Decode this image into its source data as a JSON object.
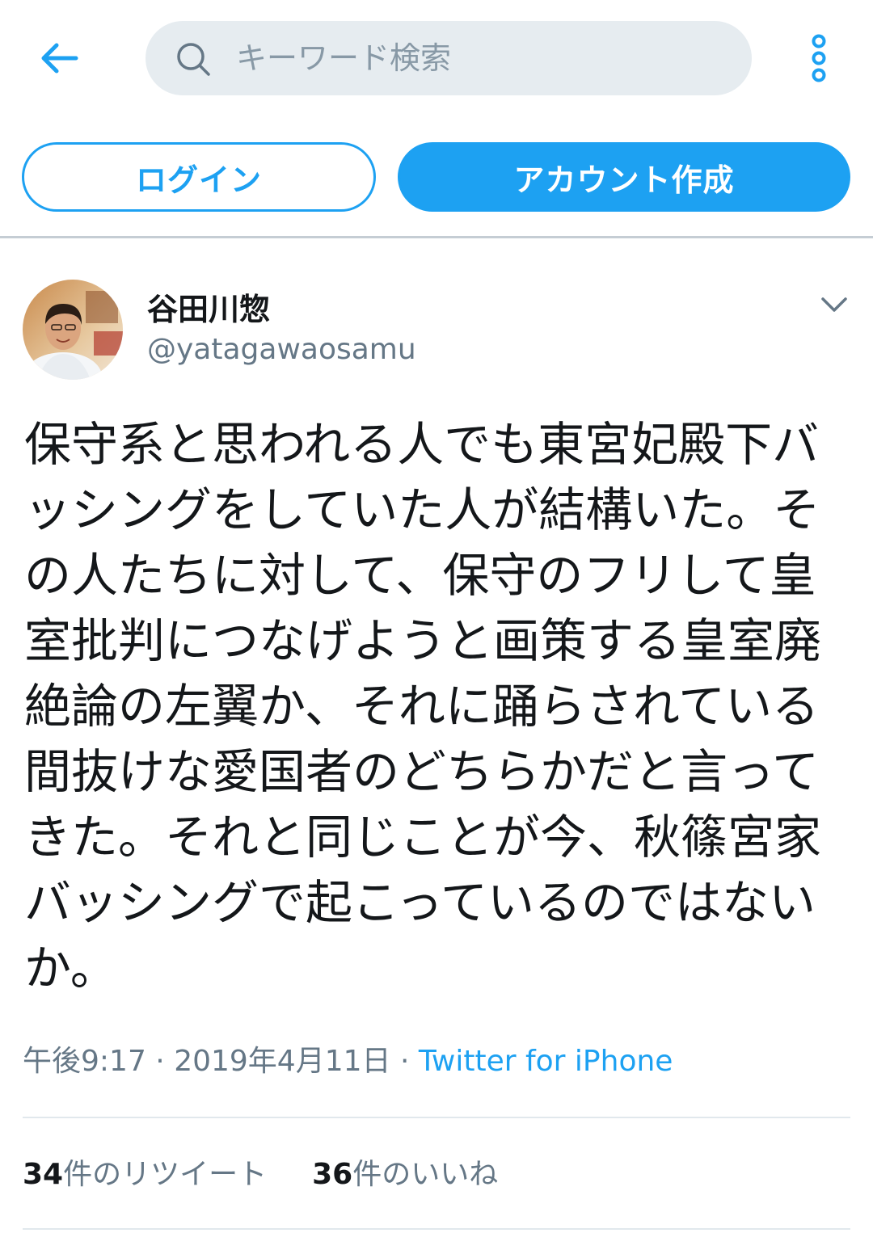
{
  "topbar": {
    "back_icon": "arrow-left-icon",
    "search": {
      "icon": "search-icon",
      "placeholder": "キーワード検索",
      "value": ""
    },
    "more_icon": "more-vertical-icon"
  },
  "auth": {
    "login_label": "ログイン",
    "signup_label": "アカウント作成"
  },
  "tweet": {
    "author": {
      "display_name": "谷田川惣",
      "handle": "@yatagawaosamu"
    },
    "caret_icon": "chevron-down-icon",
    "text": "保守系と思われる人でも東宮妃殿下バッシングをしていた人が結構いた。その人たちに対して、保守のフリして皇室批判につなげようと画策する皇室廃絶論の左翼か、それに踊らされている間抜けな愛国者のどちらかだと言ってきた。それと同じことが今、秋篠宮家バッシングで起こっているのではないか。",
    "time": "午後9:17",
    "separator": " · ",
    "date": "2019年4月11日",
    "source": "Twitter for iPhone",
    "retweets": {
      "count": "34",
      "label": "件のリツイート"
    },
    "likes": {
      "count": "36",
      "label": "件のいいね"
    }
  },
  "colors": {
    "accent": "#1da1f2",
    "text_primary": "#14171a",
    "text_secondary": "#657786",
    "search_bg": "#e6ecf0"
  }
}
